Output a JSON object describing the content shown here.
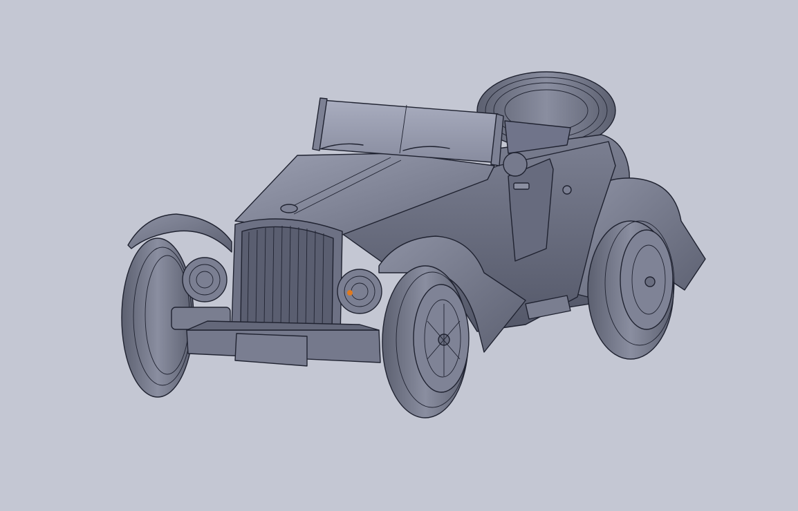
{
  "viewport": {
    "background_color": "#c4c7d3"
  },
  "model": {
    "shading_color": "#6f7385",
    "edge_color": "#1f2230",
    "highlight_color": "#e07a1f",
    "description_parts": [
      "windshield",
      "hood",
      "radiator-grille",
      "headlights",
      "front-bumper",
      "license-plate",
      "front-wheels",
      "rear-wheel",
      "spare-tire",
      "fenders",
      "door",
      "running-board"
    ]
  }
}
